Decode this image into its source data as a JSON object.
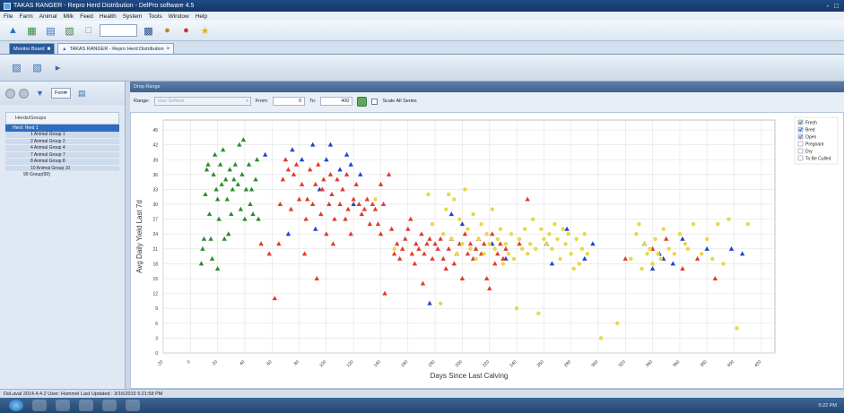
{
  "window": {
    "title": "TAKAS RANGER - Repro Herd Distribution - DelPro software 4.5",
    "controls": [
      "-",
      "□"
    ]
  },
  "menu": [
    "File",
    "Farm",
    "Animal",
    "Milk",
    "Feed",
    "Health",
    "System",
    "Tools",
    "Window",
    "Help"
  ],
  "tabs": {
    "monitor": "Monitor Board",
    "active": "TAKAS RANGER - Repro Herd Distribution"
  },
  "left_panel": {
    "font_label": "Font",
    "header": "Herds/Groups",
    "root": "Herd: Herd 1",
    "groups": [
      "1 Animal Group 1",
      "2 Animal Group 2",
      "4 Animal Group 4",
      "7 Animal Group 7",
      "8 Animal Group 8",
      "10 Animal Group 10"
    ],
    "extra": "99 Group(99)"
  },
  "panel_title": "Drop Range",
  "range": {
    "label": "Range:",
    "value": "User Defined",
    "from_label": "From:",
    "from": "0",
    "to_label": "To:",
    "to": "400",
    "scale_all": "Scale All Series"
  },
  "chart_data": {
    "type": "scatter",
    "xlabel": "Days Since Last Calving",
    "ylabel": "Avg Daily Yield Last 7d",
    "xlim": [
      -20,
      430
    ],
    "ylim": [
      0,
      47
    ],
    "x_ticks": [
      -20,
      0,
      20,
      40,
      60,
      80,
      100,
      120,
      140,
      160,
      180,
      200,
      220,
      240,
      260,
      280,
      300,
      320,
      340,
      360,
      380,
      400,
      420
    ],
    "y_ticks": [
      0,
      3,
      6,
      9,
      12,
      15,
      18,
      21,
      24,
      27,
      30,
      33,
      36,
      39,
      42,
      45
    ],
    "legend": [
      "Fresh",
      "Bred",
      "Open",
      "Pregnant",
      "Dry",
      "To Be Culled"
    ],
    "legend_checked": [
      true,
      true,
      true,
      false,
      false,
      false
    ],
    "series": [
      {
        "name": "Fresh",
        "color": "#2e8b2e",
        "marker": "triangle",
        "points": [
          [
            8,
            18
          ],
          [
            9,
            21
          ],
          [
            10,
            23
          ],
          [
            11,
            32
          ],
          [
            12,
            37
          ],
          [
            13,
            38
          ],
          [
            14,
            28
          ],
          [
            15,
            23
          ],
          [
            16,
            19
          ],
          [
            17,
            36
          ],
          [
            18,
            40
          ],
          [
            19,
            33
          ],
          [
            20,
            31
          ],
          [
            20,
            17
          ],
          [
            21,
            27
          ],
          [
            22,
            38
          ],
          [
            23,
            34
          ],
          [
            24,
            41
          ],
          [
            25,
            23
          ],
          [
            26,
            35
          ],
          [
            27,
            31
          ],
          [
            28,
            24
          ],
          [
            29,
            37
          ],
          [
            30,
            28
          ],
          [
            31,
            33
          ],
          [
            32,
            35
          ],
          [
            33,
            38
          ],
          [
            35,
            34
          ],
          [
            36,
            42
          ],
          [
            37,
            29
          ],
          [
            38,
            36
          ],
          [
            39,
            43
          ],
          [
            40,
            27
          ],
          [
            41,
            33
          ],
          [
            43,
            38
          ],
          [
            44,
            30
          ],
          [
            45,
            33
          ],
          [
            46,
            28
          ],
          [
            48,
            35
          ],
          [
            49,
            39
          ],
          [
            50,
            27
          ]
        ]
      },
      {
        "name": "Bred",
        "color": "#2244cc",
        "marker": "triangle",
        "points": [
          [
            55,
            40
          ],
          [
            75,
            41
          ],
          [
            82,
            39
          ],
          [
            90,
            42
          ],
          [
            95,
            33
          ],
          [
            100,
            39
          ],
          [
            103,
            42
          ],
          [
            110,
            37
          ],
          [
            115,
            40
          ],
          [
            118,
            38
          ],
          [
            120,
            30
          ],
          [
            125,
            36
          ],
          [
            72,
            24
          ],
          [
            92,
            25
          ],
          [
            176,
            10
          ],
          [
            192,
            28
          ],
          [
            200,
            26
          ],
          [
            222,
            22
          ],
          [
            232,
            19
          ],
          [
            262,
            22
          ],
          [
            266,
            18
          ],
          [
            277,
            25
          ],
          [
            290,
            19
          ],
          [
            296,
            22
          ],
          [
            334,
            22
          ],
          [
            340,
            17
          ],
          [
            345,
            20
          ],
          [
            348,
            19
          ],
          [
            355,
            18
          ],
          [
            362,
            23
          ],
          [
            380,
            21
          ],
          [
            398,
            21
          ],
          [
            406,
            20
          ]
        ]
      },
      {
        "name": "Open",
        "color": "#e03a2a",
        "marker": "triangle",
        "points": [
          [
            52,
            22
          ],
          [
            58,
            20
          ],
          [
            62,
            11
          ],
          [
            65,
            22
          ],
          [
            66,
            30
          ],
          [
            68,
            35
          ],
          [
            70,
            39
          ],
          [
            72,
            37
          ],
          [
            74,
            29
          ],
          [
            76,
            36
          ],
          [
            78,
            38
          ],
          [
            80,
            31
          ],
          [
            82,
            34
          ],
          [
            84,
            20
          ],
          [
            85,
            27
          ],
          [
            86,
            31
          ],
          [
            88,
            37
          ],
          [
            90,
            30
          ],
          [
            92,
            34
          ],
          [
            93,
            15
          ],
          [
            94,
            38
          ],
          [
            96,
            28
          ],
          [
            97,
            33
          ],
          [
            98,
            35
          ],
          [
            100,
            24
          ],
          [
            102,
            30
          ],
          [
            103,
            36
          ],
          [
            104,
            32
          ],
          [
            105,
            22
          ],
          [
            106,
            27
          ],
          [
            108,
            35
          ],
          [
            110,
            30
          ],
          [
            112,
            33
          ],
          [
            114,
            27
          ],
          [
            115,
            36
          ],
          [
            116,
            29
          ],
          [
            118,
            24
          ],
          [
            120,
            31
          ],
          [
            122,
            34
          ],
          [
            124,
            30
          ],
          [
            126,
            28
          ],
          [
            128,
            29
          ],
          [
            130,
            31
          ],
          [
            132,
            26
          ],
          [
            134,
            30
          ],
          [
            136,
            29
          ],
          [
            138,
            26
          ],
          [
            140,
            24
          ],
          [
            140,
            34
          ],
          [
            142,
            30
          ],
          [
            143,
            12
          ],
          [
            146,
            36
          ],
          [
            148,
            25
          ],
          [
            150,
            20
          ],
          [
            152,
            22
          ],
          [
            154,
            19
          ],
          [
            156,
            21
          ],
          [
            158,
            23
          ],
          [
            160,
            25
          ],
          [
            162,
            27
          ],
          [
            163,
            20
          ],
          [
            165,
            18
          ],
          [
            166,
            22
          ],
          [
            168,
            21
          ],
          [
            170,
            24
          ],
          [
            171,
            14
          ],
          [
            172,
            20
          ],
          [
            174,
            22
          ],
          [
            176,
            23
          ],
          [
            178,
            19
          ],
          [
            180,
            22
          ],
          [
            182,
            21
          ],
          [
            184,
            23
          ],
          [
            186,
            19
          ],
          [
            188,
            17
          ],
          [
            190,
            21
          ],
          [
            192,
            23
          ],
          [
            194,
            18
          ],
          [
            196,
            20
          ],
          [
            198,
            22
          ],
          [
            200,
            15
          ],
          [
            202,
            24
          ],
          [
            204,
            20
          ],
          [
            206,
            22
          ],
          [
            208,
            19
          ],
          [
            210,
            21
          ],
          [
            212,
            23
          ],
          [
            214,
            20
          ],
          [
            216,
            22
          ],
          [
            218,
            15
          ],
          [
            220,
            13
          ],
          [
            222,
            24
          ],
          [
            224,
            18
          ],
          [
            226,
            20
          ],
          [
            228,
            22
          ],
          [
            230,
            19
          ],
          [
            232,
            21
          ],
          [
            242,
            22
          ],
          [
            248,
            31
          ],
          [
            320,
            19
          ],
          [
            340,
            21
          ],
          [
            350,
            23
          ],
          [
            362,
            17
          ],
          [
            373,
            19
          ],
          [
            386,
            15
          ]
        ]
      },
      {
        "name": "Pregnant",
        "color": "#e6d84a",
        "marker": "circle",
        "points": [
          [
            136,
            31
          ],
          [
            150,
            21
          ],
          [
            175,
            32
          ],
          [
            178,
            26
          ],
          [
            184,
            10
          ],
          [
            186,
            24
          ],
          [
            188,
            29
          ],
          [
            190,
            32
          ],
          [
            192,
            23
          ],
          [
            194,
            31
          ],
          [
            196,
            20
          ],
          [
            198,
            27
          ],
          [
            200,
            22
          ],
          [
            202,
            33
          ],
          [
            204,
            25
          ],
          [
            206,
            21
          ],
          [
            208,
            28
          ],
          [
            210,
            19
          ],
          [
            212,
            23
          ],
          [
            214,
            26
          ],
          [
            216,
            20
          ],
          [
            218,
            24
          ],
          [
            220,
            22
          ],
          [
            222,
            29
          ],
          [
            224,
            21
          ],
          [
            226,
            23
          ],
          [
            228,
            25
          ],
          [
            230,
            18
          ],
          [
            232,
            22
          ],
          [
            234,
            20
          ],
          [
            236,
            24
          ],
          [
            238,
            19
          ],
          [
            240,
            9
          ],
          [
            242,
            23
          ],
          [
            244,
            21
          ],
          [
            246,
            25
          ],
          [
            248,
            20
          ],
          [
            250,
            22
          ],
          [
            252,
            27
          ],
          [
            254,
            21
          ],
          [
            256,
            8
          ],
          [
            258,
            25
          ],
          [
            260,
            23
          ],
          [
            262,
            22
          ],
          [
            264,
            24
          ],
          [
            266,
            21
          ],
          [
            268,
            26
          ],
          [
            270,
            23
          ],
          [
            272,
            19
          ],
          [
            274,
            25
          ],
          [
            276,
            22
          ],
          [
            278,
            24
          ],
          [
            280,
            20
          ],
          [
            282,
            17
          ],
          [
            284,
            23
          ],
          [
            286,
            18
          ],
          [
            288,
            21
          ],
          [
            290,
            24
          ],
          [
            292,
            20
          ],
          [
            302,
            3
          ],
          [
            314,
            6
          ],
          [
            324,
            19
          ],
          [
            328,
            24
          ],
          [
            330,
            26
          ],
          [
            332,
            17
          ],
          [
            334,
            22
          ],
          [
            336,
            20
          ],
          [
            338,
            21
          ],
          [
            340,
            18
          ],
          [
            342,
            23
          ],
          [
            344,
            20
          ],
          [
            346,
            19
          ],
          [
            348,
            25
          ],
          [
            352,
            21
          ],
          [
            356,
            20
          ],
          [
            360,
            24
          ],
          [
            364,
            22
          ],
          [
            366,
            21
          ],
          [
            370,
            26
          ],
          [
            376,
            20
          ],
          [
            380,
            23
          ],
          [
            384,
            19
          ],
          [
            388,
            26
          ],
          [
            392,
            18
          ],
          [
            396,
            27
          ],
          [
            402,
            5
          ],
          [
            410,
            26
          ]
        ]
      }
    ]
  },
  "status": {
    "text": "DeLaval  2014.4.4.2  User: Hummel  Last Updated : 3/16/2015 5:21:58 PM"
  },
  "taskbar": {
    "clock": "5:22 PM"
  }
}
